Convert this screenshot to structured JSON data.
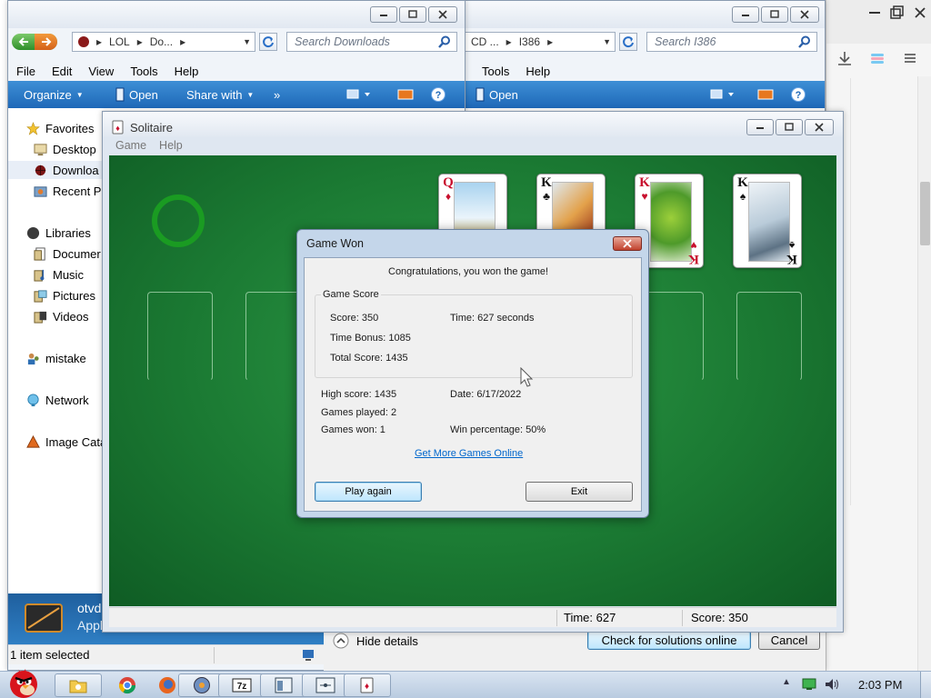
{
  "explorer_left": {
    "address": [
      "LOL",
      "Do..."
    ],
    "search_placeholder": "Search Downloads",
    "menu": [
      "File",
      "Edit",
      "View",
      "Tools",
      "Help"
    ],
    "toolbar": {
      "organize": "Organize",
      "open": "Open",
      "share_with": "Share with",
      "more": "»"
    },
    "nav": {
      "favorites": "Favorites",
      "desktop": "Desktop",
      "downloads": "Downloa",
      "recent": "Recent Pl",
      "libraries": "Libraries",
      "documents": "Documer",
      "music": "Music",
      "pictures": "Pictures",
      "videos": "Videos",
      "mistake": "mistake",
      "network": "Network",
      "image_catalog": "Image Cata"
    },
    "details": {
      "name": "otvd",
      "type": "Appl"
    },
    "status": "1 item selected"
  },
  "explorer_right": {
    "address": [
      "CD ...",
      "I386"
    ],
    "search_placeholder": "Search I386",
    "menu": [
      "Tools",
      "Help"
    ],
    "toolbar": {
      "open": "Open"
    }
  },
  "bg_dialog": {
    "hide_details": "Hide details",
    "check_online": "Check for solutions online",
    "cancel": "Cancel"
  },
  "solitaire": {
    "title": "Solitaire",
    "menu": [
      "Game",
      "Help"
    ],
    "foundation_cards": [
      {
        "rank": "Q",
        "suit": "♦",
        "color": "red"
      },
      {
        "rank": "K",
        "suit": "♣",
        "color": "black"
      },
      {
        "rank": "K",
        "suit": "♥",
        "color": "red"
      },
      {
        "rank": "K",
        "suit": "♠",
        "color": "black"
      }
    ],
    "status": {
      "time": "Time:  627",
      "score": "Score: 350"
    }
  },
  "dialog": {
    "title": "Game Won",
    "message": "Congratulations, you won the game!",
    "group_label": "Game Score",
    "score": "Score: 350",
    "time": "Time:  627 seconds",
    "time_bonus": "Time Bonus: 1085",
    "total_score": "Total Score: 1435",
    "high_score": "High score: 1435",
    "date": "Date: 6/17/2022",
    "games_played": "Games played: 2",
    "games_won": "Games won: 1",
    "win_percentage": "Win percentage: 50%",
    "link": "Get More Games Online",
    "play_again": "Play again",
    "exit": "Exit"
  },
  "taskbar": {
    "clock": "2:03 PM"
  },
  "colors": {
    "felt": "#1b7a33",
    "command_bar": "#1e68b8",
    "dialog_frame": "#c4d6ea",
    "link": "#0066cc"
  }
}
